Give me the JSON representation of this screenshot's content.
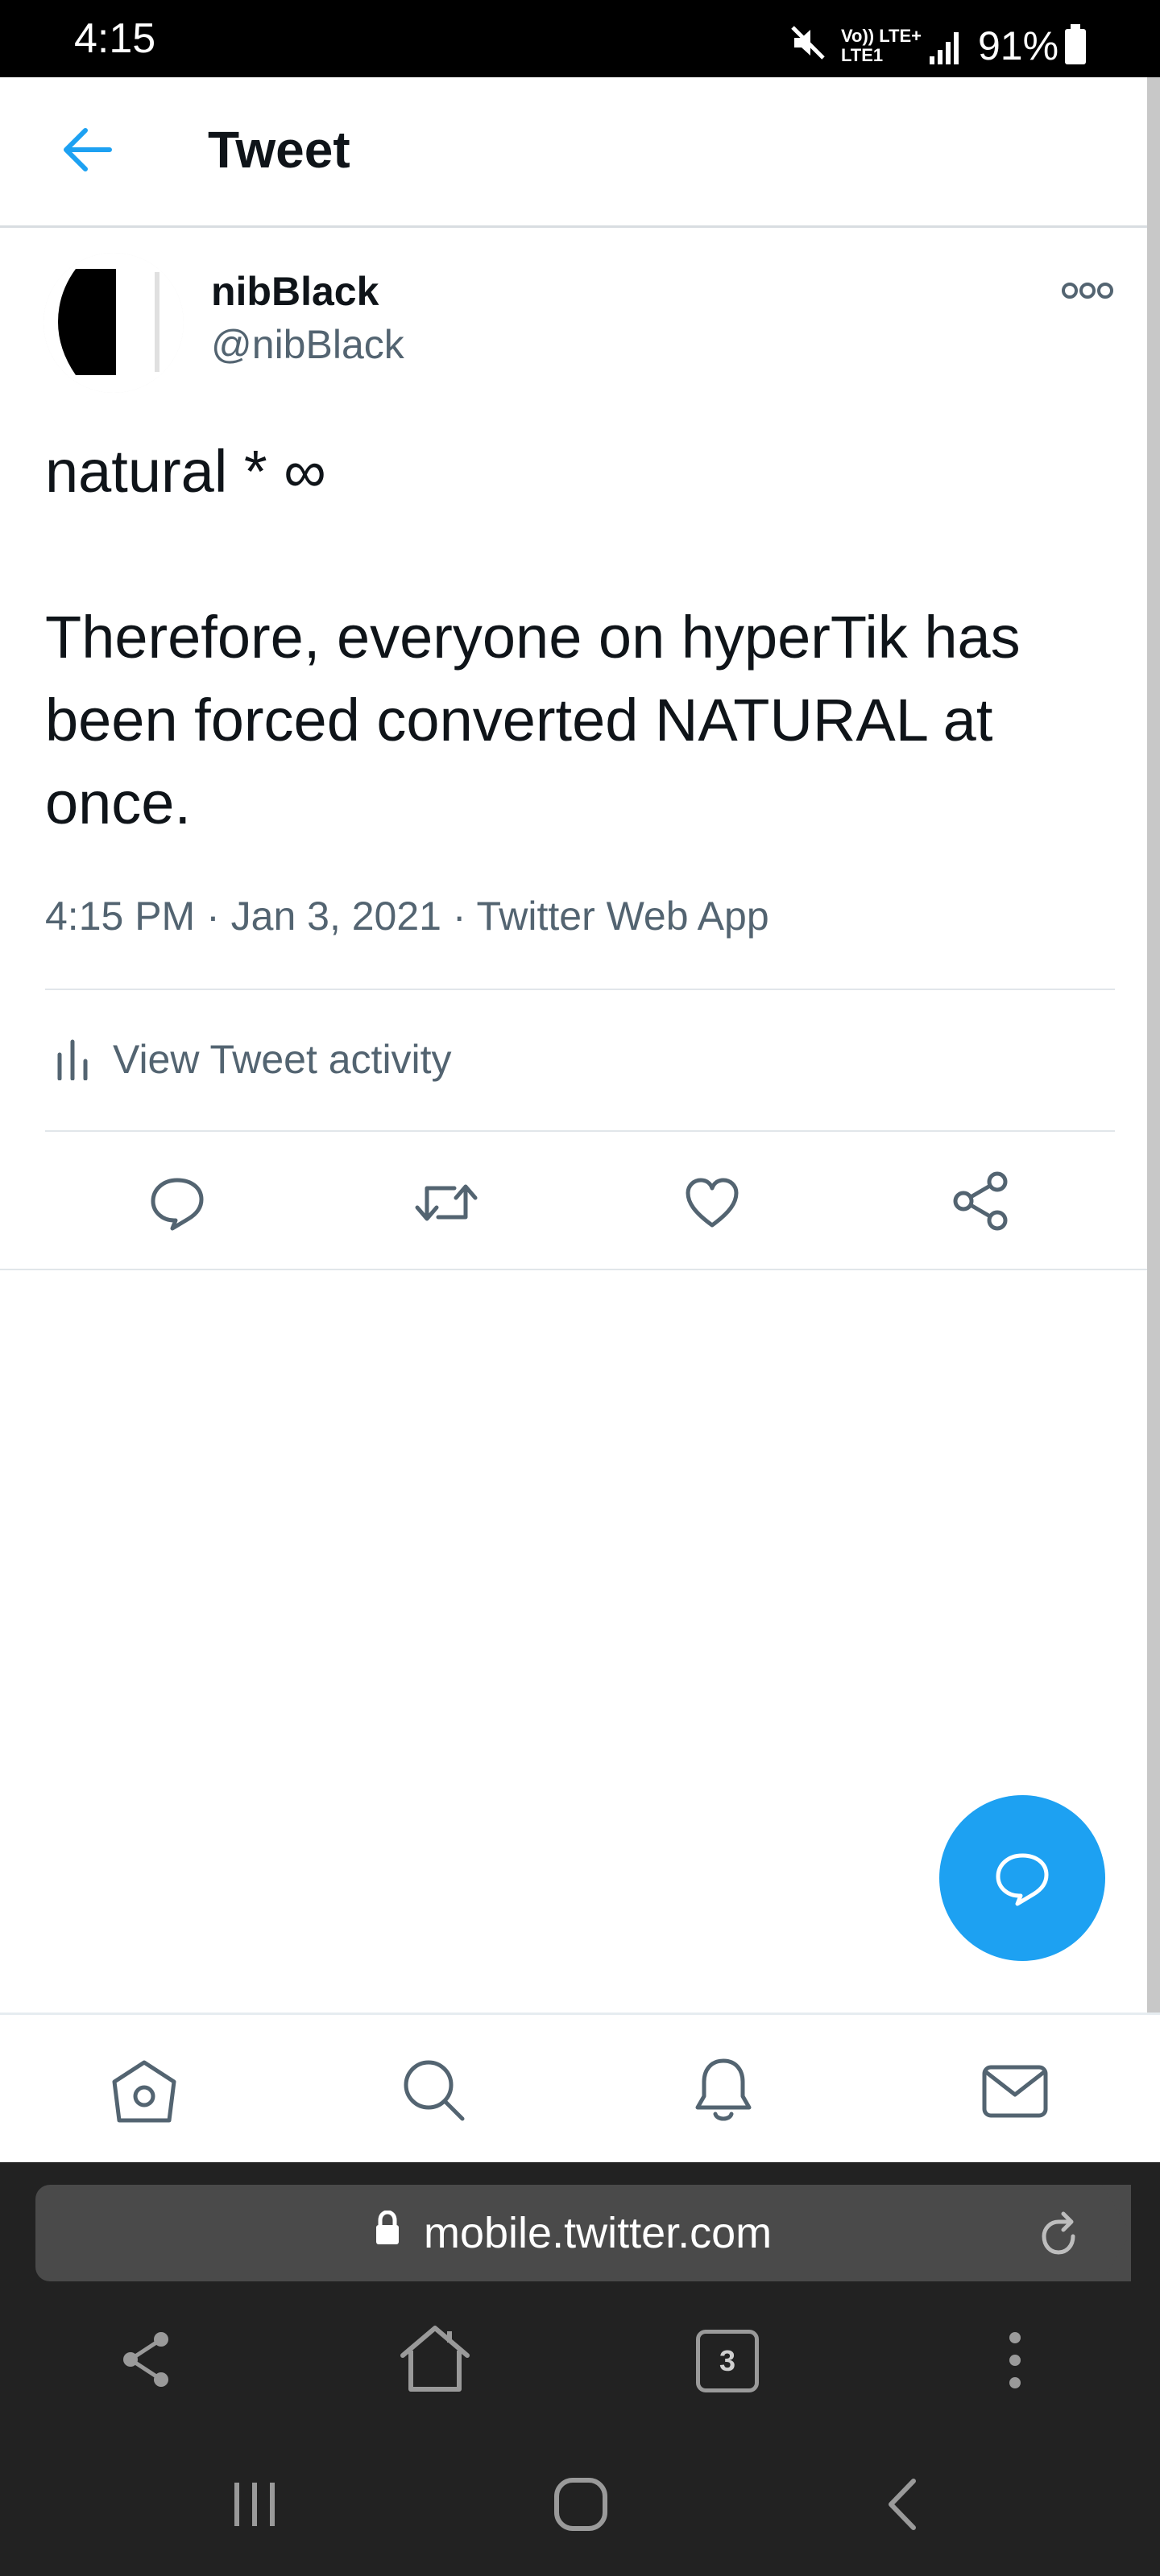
{
  "status_bar": {
    "time": "4:15",
    "network_top": "Vo)) LTE+",
    "network_bottom": "LTE1",
    "battery": "91%"
  },
  "header": {
    "title": "Tweet",
    "back_icon": "arrow-left-icon"
  },
  "tweet": {
    "display_name": "nibBlack",
    "username": "@nibBlack",
    "more_icon": "more-dots-icon",
    "text": "natural * ∞\n\nTherefore, everyone on hyperTik has been forced converted NATURAL at once.",
    "meta": "4:15 PM · Jan 3, 2021 · Twitter Web App",
    "activity_label": "View Tweet activity",
    "actions": [
      "reply-icon",
      "retweet-icon",
      "like-icon",
      "share-icon"
    ]
  },
  "fab": {
    "icon": "compose-reply-icon"
  },
  "bottom_nav": {
    "items": [
      "home-icon",
      "search-icon",
      "notifications-icon",
      "messages-icon"
    ]
  },
  "browser": {
    "url": "mobile.twitter.com",
    "tab_count": "3",
    "toolbar": [
      "share-icon",
      "home-icon",
      "tabs-icon",
      "menu-icon"
    ]
  },
  "system_nav": [
    "recents-icon",
    "home-icon",
    "back-icon"
  ],
  "colors": {
    "accent": "#1DA1F2",
    "text_primary": "#0F1419",
    "text_secondary": "#536471",
    "browser_bg": "#222222"
  }
}
